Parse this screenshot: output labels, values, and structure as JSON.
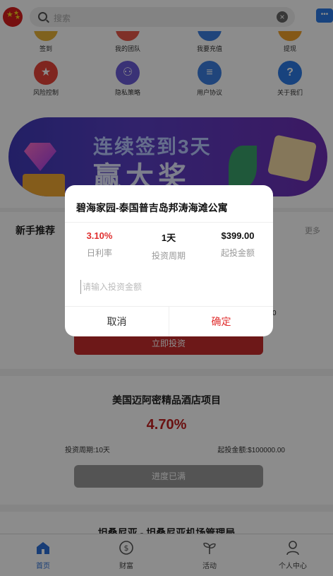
{
  "header": {
    "search_placeholder": "搜索",
    "clear_icon": "close-circle-icon",
    "chat_icon": "chat-bubble-icon"
  },
  "quick_top": [
    {
      "label": "签到",
      "color": "#e8b23a"
    },
    {
      "label": "我的团队",
      "color": "#e8584a"
    },
    {
      "label": "我要充值",
      "color": "#3b7fe0"
    },
    {
      "label": "提现",
      "color": "#f0a02a"
    }
  ],
  "quick_bottom": [
    {
      "label": "风险控制",
      "color": "#e8443a",
      "icon": "star-shield-icon",
      "sym": "★"
    },
    {
      "label": "隐私策略",
      "color": "#6a5bd8",
      "icon": "privacy-icon",
      "sym": "⚇"
    },
    {
      "label": "用户协议",
      "color": "#3b7fe0",
      "icon": "agreement-icon",
      "sym": "≡"
    },
    {
      "label": "关于我们",
      "color": "#2c7be5",
      "icon": "question-icon",
      "sym": "?"
    }
  ],
  "banner": {
    "line1": "连续签到3天",
    "line2": "赢大奖"
  },
  "newuser": {
    "title": "新手推荐",
    "more": "更多",
    "partial_text": "0",
    "invest_button": "立即投资"
  },
  "product2": {
    "title": "美国迈阿密精品酒店项目",
    "rate": "4.70%",
    "period": "投资周期:10天",
    "min": "起投金额:$100000.00",
    "status_button": "进度已满"
  },
  "product3": {
    "title": "坦桑尼亚 - 坦桑尼亚机场管理局"
  },
  "modal": {
    "title": "碧海家园-泰国普吉岛邦涛海滩公寓",
    "rate_value": "3.10%",
    "rate_label": "日利率",
    "period_value": "1天",
    "period_label": "投资周期",
    "min_value": "$399.00",
    "min_label": "起投金额",
    "input_placeholder": "请输入投资金额",
    "cancel": "取消",
    "confirm": "确定"
  },
  "nav": [
    {
      "label": "首页",
      "icon": "home-icon",
      "active": true
    },
    {
      "label": "财富",
      "icon": "wealth-icon",
      "active": false
    },
    {
      "label": "活动",
      "icon": "sprout-icon",
      "active": false
    },
    {
      "label": "个人中心",
      "icon": "user-icon",
      "active": false
    }
  ],
  "colors": {
    "accent_red": "#e02e2e",
    "nav_active": "#2c6fd8"
  }
}
